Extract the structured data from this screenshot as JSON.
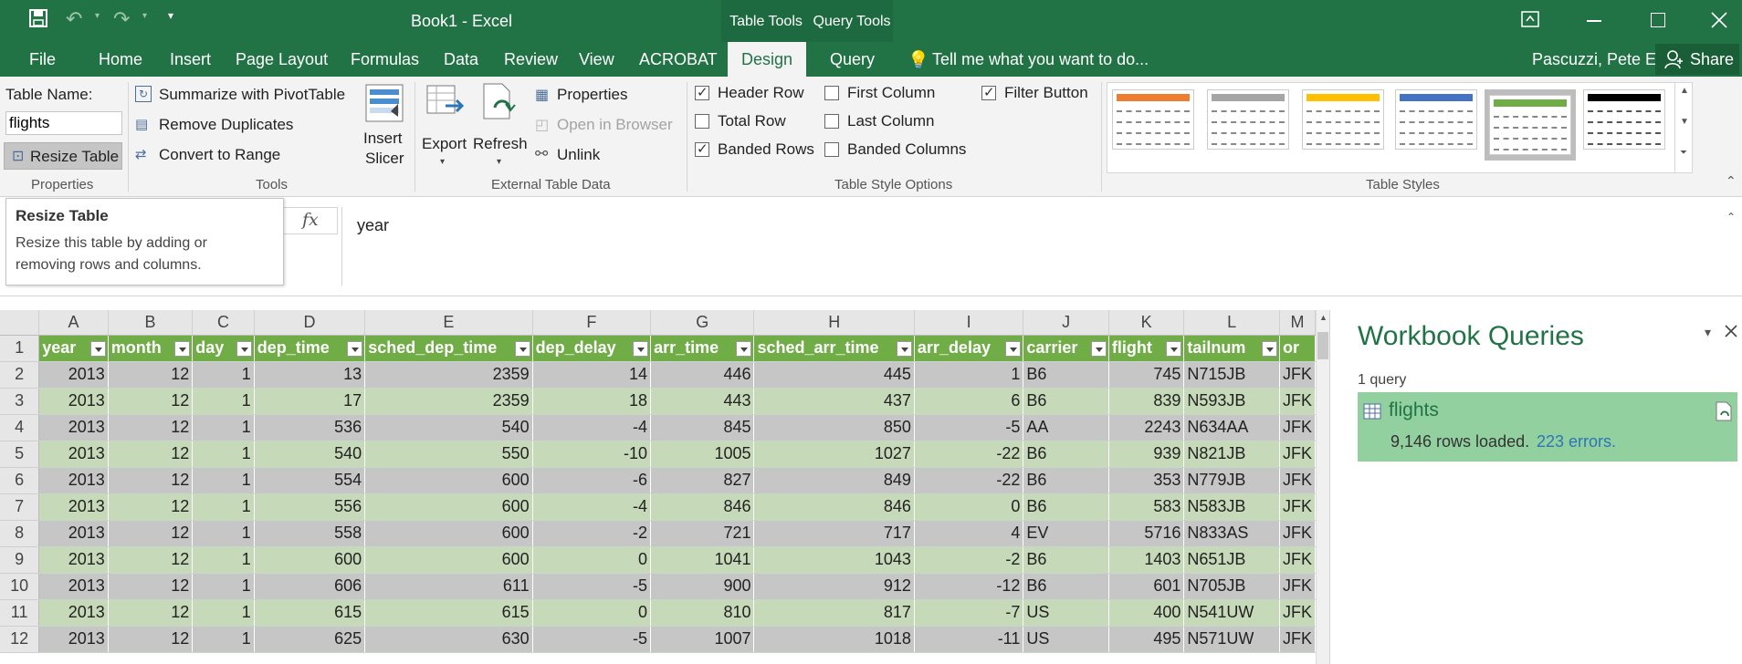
{
  "app": {
    "title": "Book1 - Excel",
    "context_tabs": [
      "Table Tools",
      "Query Tools"
    ],
    "user": "Pascuzzi, Pete E",
    "share_label": "Share"
  },
  "tabs": [
    "File",
    "Home",
    "Insert",
    "Page Layout",
    "Formulas",
    "Data",
    "Review",
    "View",
    "ACROBAT",
    "Design",
    "Query"
  ],
  "tell_me": "Tell me what you want to do...",
  "ribbon": {
    "properties": {
      "table_name_label": "Table Name:",
      "table_name_value": "flights",
      "resize_label": "Resize Table",
      "group": "Properties"
    },
    "tools": {
      "pivot": "Summarize with PivotTable",
      "remove_dup": "Remove Duplicates",
      "convert": "Convert to Range",
      "slicer_1": "Insert",
      "slicer_2": "Slicer",
      "group": "Tools"
    },
    "external": {
      "export": "Export",
      "refresh": "Refresh",
      "properties": "Properties",
      "open_browser": "Open in Browser",
      "unlink": "Unlink",
      "group": "External Table Data"
    },
    "style_options": {
      "header_row": "Header Row",
      "total_row": "Total Row",
      "banded_rows": "Banded Rows",
      "first_column": "First Column",
      "last_column": "Last Column",
      "banded_columns": "Banded Columns",
      "filter_button": "Filter Button",
      "group": "Table Style Options"
    },
    "styles_group": "Table Styles",
    "style_colors": [
      "#ed7d31",
      "#a5a5a5",
      "#ffc000",
      "#4472c4",
      "#70ad47",
      "#000000"
    ]
  },
  "tooltip": {
    "title": "Resize Table",
    "body_1": "Resize this table by adding or",
    "body_2": "removing rows and columns."
  },
  "formula": {
    "fx": "fx",
    "value": "year"
  },
  "grid": {
    "col_letters": [
      "A",
      "B",
      "C",
      "D",
      "E",
      "F",
      "G",
      "H",
      "I",
      "J",
      "K",
      "L",
      "M"
    ],
    "headers": [
      "year",
      "month",
      "day",
      "dep_time",
      "sched_dep_time",
      "dep_delay",
      "arr_time",
      "sched_arr_time",
      "arr_delay",
      "carrier",
      "flight",
      "tailnum",
      "or"
    ],
    "rows": [
      {
        "n": "2",
        "v": [
          "2013",
          "12",
          "1",
          "13",
          "2359",
          "14",
          "446",
          "445",
          "1",
          "B6",
          "745",
          "N715JB",
          "JFK"
        ]
      },
      {
        "n": "3",
        "v": [
          "2013",
          "12",
          "1",
          "17",
          "2359",
          "18",
          "443",
          "437",
          "6",
          "B6",
          "839",
          "N593JB",
          "JFK"
        ]
      },
      {
        "n": "4",
        "v": [
          "2013",
          "12",
          "1",
          "536",
          "540",
          "-4",
          "845",
          "850",
          "-5",
          "AA",
          "2243",
          "N634AA",
          "JFK"
        ]
      },
      {
        "n": "5",
        "v": [
          "2013",
          "12",
          "1",
          "540",
          "550",
          "-10",
          "1005",
          "1027",
          "-22",
          "B6",
          "939",
          "N821JB",
          "JFK"
        ]
      },
      {
        "n": "6",
        "v": [
          "2013",
          "12",
          "1",
          "554",
          "600",
          "-6",
          "827",
          "849",
          "-22",
          "B6",
          "353",
          "N779JB",
          "JFK"
        ]
      },
      {
        "n": "7",
        "v": [
          "2013",
          "12",
          "1",
          "556",
          "600",
          "-4",
          "846",
          "846",
          "0",
          "B6",
          "583",
          "N583JB",
          "JFK"
        ]
      },
      {
        "n": "8",
        "v": [
          "2013",
          "12",
          "1",
          "558",
          "600",
          "-2",
          "721",
          "717",
          "4",
          "EV",
          "5716",
          "N833AS",
          "JFK"
        ]
      },
      {
        "n": "9",
        "v": [
          "2013",
          "12",
          "1",
          "600",
          "600",
          "0",
          "1041",
          "1043",
          "-2",
          "B6",
          "1403",
          "N651JB",
          "JFK"
        ]
      },
      {
        "n": "10",
        "v": [
          "2013",
          "12",
          "1",
          "606",
          "611",
          "-5",
          "900",
          "912",
          "-12",
          "B6",
          "601",
          "N705JB",
          "JFK"
        ]
      },
      {
        "n": "11",
        "v": [
          "2013",
          "12",
          "1",
          "615",
          "615",
          "0",
          "810",
          "817",
          "-7",
          "US",
          "400",
          "N541UW",
          "JFK"
        ]
      },
      {
        "n": "12",
        "v": [
          "2013",
          "12",
          "1",
          "625",
          "630",
          "-5",
          "1007",
          "1018",
          "-11",
          "US",
          "495",
          "N571UW",
          "JFK"
        ]
      }
    ]
  },
  "queries": {
    "title": "Workbook Queries",
    "count": "1 query",
    "name": "flights",
    "rows_loaded": "9,146 rows loaded.",
    "errors": "223 errors."
  }
}
